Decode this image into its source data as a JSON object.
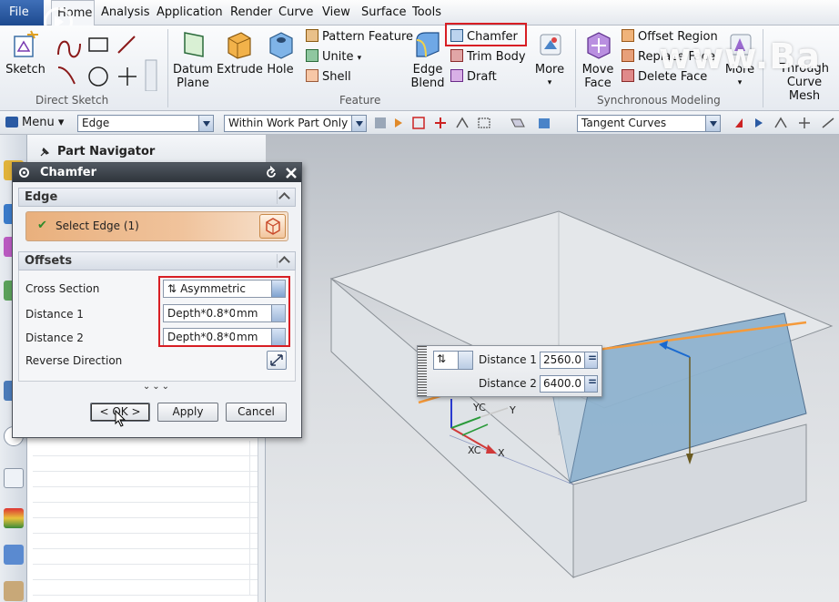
{
  "menu_bar": {
    "file": "File",
    "items": [
      "Home",
      "Analysis",
      "Application",
      "Render",
      "Curve",
      "View",
      "Surface",
      "Tools"
    ]
  },
  "watermark": "www.Ba",
  "ribbon": {
    "direct_sketch": {
      "sketch": "Sketch",
      "group_label": "Direct Sketch"
    },
    "feature": {
      "datum_plane": "Datum Plane",
      "extrude": "Extrude",
      "hole": "Hole",
      "pattern_feature": "Pattern Feature",
      "unite": "Unite",
      "shell": "Shell",
      "edge_blend": "Edge Blend",
      "chamfer": "Chamfer",
      "trim_body": "Trim Body",
      "draft": "Draft",
      "more": "More",
      "group_label": "Feature"
    },
    "sync_modeling": {
      "move_face": "Move Face",
      "offset_region": "Offset Region",
      "replace_face": "Replace Face",
      "delete_face": "Delete Face",
      "more": "More",
      "group_label": "Synchronous Modeling"
    },
    "through_curve_mesh": "Through Curve Mesh"
  },
  "selection_bar": {
    "menu": "Menu",
    "type_filter": "Edge",
    "scope": "Within Work Part Only",
    "curve_rule": "Tangent Curves"
  },
  "part_navigator": {
    "title": "Part Navigator"
  },
  "dialog": {
    "title": "Chamfer",
    "edge_section": "Edge",
    "select_edge": "Select Edge (1)",
    "offsets_section": "Offsets",
    "cross_section_label": "Cross Section",
    "cross_section_value": "Asymmetric",
    "distance1_label": "Distance 1",
    "distance1_value": "Depth*0.8*0",
    "distance1_unit": "mm",
    "distance2_label": "Distance 2",
    "distance2_value": "Depth*0.8*0",
    "distance2_unit": "mm",
    "reverse_direction_label": "Reverse Direction",
    "ok": "< OK >",
    "apply": "Apply",
    "cancel": "Cancel"
  },
  "onscreen_input": {
    "distance1_label": "Distance 1",
    "distance1_value": "2560.0",
    "distance2_label": "Distance 2",
    "distance2_value": "6400.0"
  },
  "triad": {
    "yc": "YC",
    "y": "Y",
    "xc": "XC",
    "x": "X"
  },
  "colors": {
    "highlight_red": "#d81e24",
    "title_bar": "#2e343b",
    "selected_edge": "#f59a3a",
    "face_blue": "#8fb3cf",
    "file_tab": "#2a5aa3"
  }
}
